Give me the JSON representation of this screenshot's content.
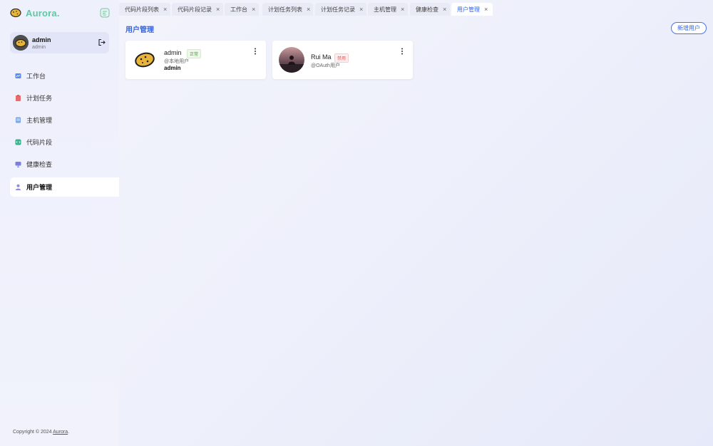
{
  "app": {
    "name": "Aurora."
  },
  "user": {
    "name": "admin",
    "sub": "admin"
  },
  "sidebar": {
    "items": [
      {
        "label": "工作台",
        "icon": "dashboard-icon",
        "color": "#5b8def"
      },
      {
        "label": "计划任务",
        "icon": "clipboard-icon",
        "color": "#e86a6a"
      },
      {
        "label": "主机管理",
        "icon": "server-icon",
        "color": "#7aa6e6"
      },
      {
        "label": "代码片段",
        "icon": "code-icon",
        "color": "#3cae8c"
      },
      {
        "label": "健康检查",
        "icon": "monitor-icon",
        "color": "#7b7fe0"
      },
      {
        "label": "用户管理",
        "icon": "user-icon",
        "color": "#8f8fd8",
        "active": true
      }
    ]
  },
  "tabs": [
    {
      "label": "代码片段列表"
    },
    {
      "label": "代码片段记录"
    },
    {
      "label": "工作台"
    },
    {
      "label": "计划任务列表"
    },
    {
      "label": "计划任务记录"
    },
    {
      "label": "主机管理"
    },
    {
      "label": "健康检查"
    },
    {
      "label": "用户管理",
      "active": true
    }
  ],
  "tab_close_glyph": "×",
  "main": {
    "title": "用户管理",
    "add_button": "新增用户",
    "users": [
      {
        "name": "admin",
        "status": "正常",
        "source": "@本地用户",
        "role": "admin"
      },
      {
        "name": "Rui Ma",
        "status": "禁用",
        "source": "@OAuth用户",
        "role": ""
      }
    ]
  },
  "footer": {
    "prefix": "Copyright © 2024 ",
    "link": "Aurora",
    "suffix": "."
  },
  "colors": {
    "accent": "#3464e0",
    "brand": "#5fc7a3",
    "ok": "#3fa33f",
    "disabled": "#e05656"
  }
}
